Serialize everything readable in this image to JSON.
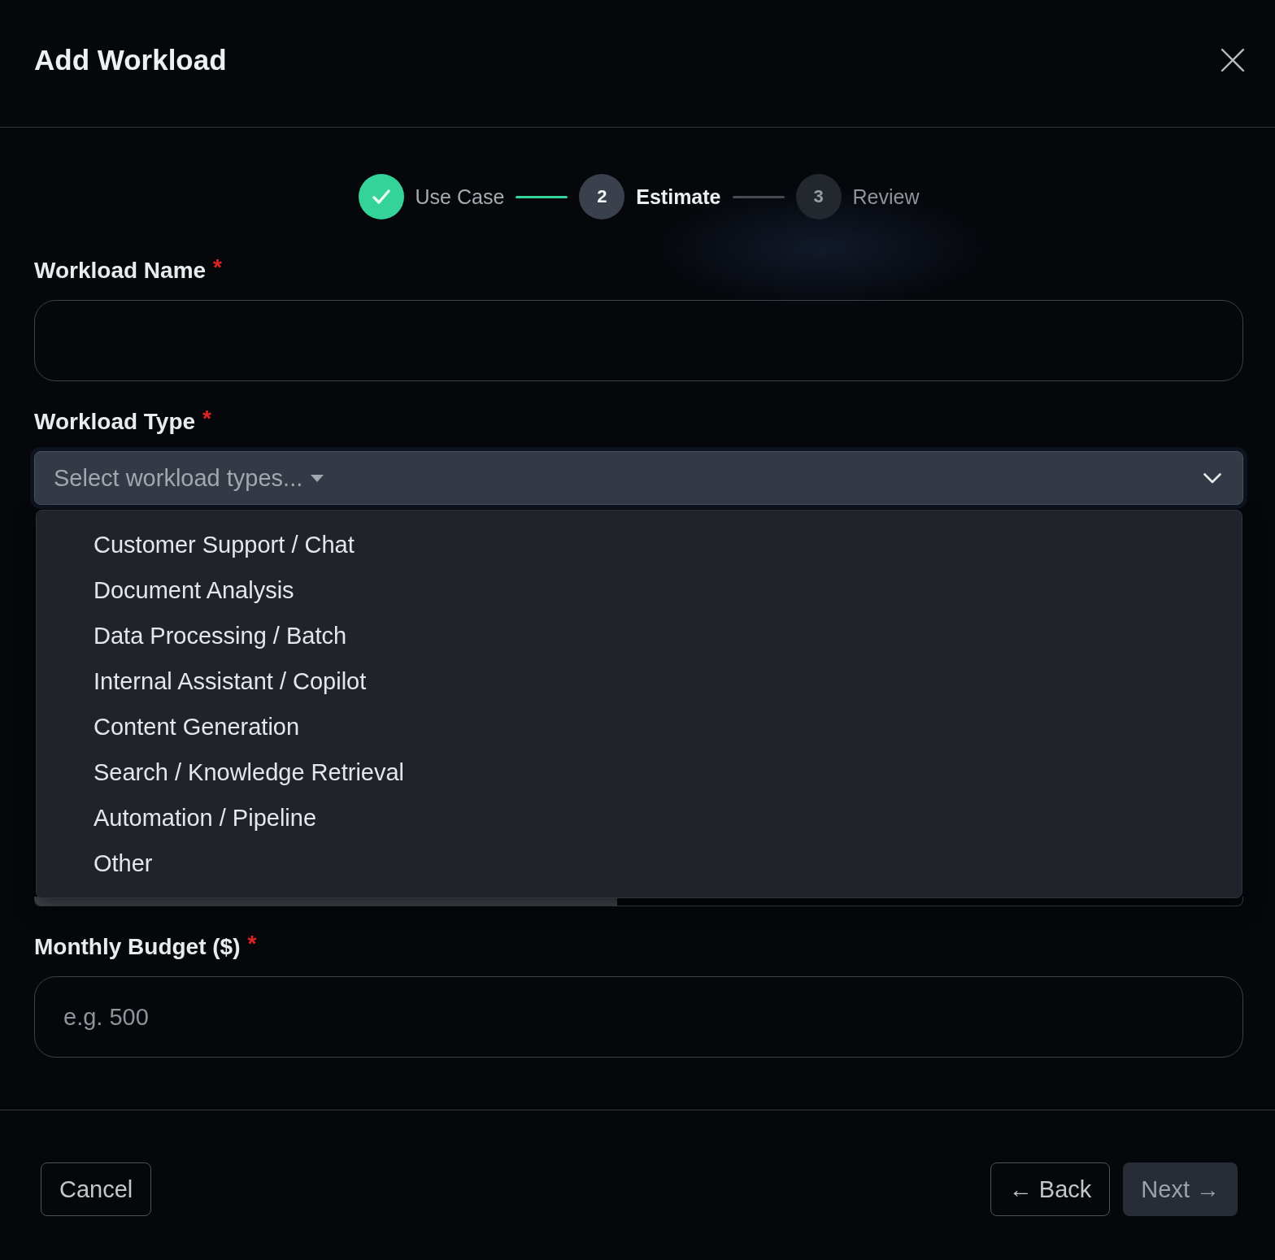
{
  "dialog": {
    "title": "Add Workload"
  },
  "steps": [
    {
      "label": "Use Case",
      "completed": true,
      "selected": false
    },
    {
      "number": "2",
      "label": "Estimate",
      "completed": false,
      "selected": true
    },
    {
      "number": "3",
      "label": "Review",
      "completed": false,
      "selected": false
    }
  ],
  "fields": [
    {
      "kind": "text",
      "label": "Workload Name",
      "required_mark": "*"
    },
    {
      "kind": "select",
      "label": "Workload Type",
      "required_mark": "*",
      "placeholder": "Select workload types...",
      "expanded": true,
      "options": [
        {
          "label": "Customer Support / Chat",
          "selected": false
        },
        {
          "label": "Document Analysis",
          "selected": false
        },
        {
          "label": "Data Processing / Batch",
          "selected": false
        },
        {
          "label": "Internal Assistant / Copilot",
          "selected": false
        },
        {
          "label": "Content Generation",
          "selected": false
        },
        {
          "label": "Search / Knowledge Retrieval",
          "selected": false
        },
        {
          "label": "Automation / Pipeline",
          "selected": false
        },
        {
          "label": "Other",
          "selected": false
        }
      ]
    },
    {
      "kind": "text",
      "label": "Monthly Budget ($)",
      "required_mark": "*",
      "placeholder": "e.g. 500"
    }
  ],
  "footer": {
    "left": [
      {
        "kind": "outline",
        "label": "Cancel",
        "disabled": false
      }
    ],
    "right": [
      {
        "kind": "outline",
        "label": "← Back",
        "disabled": false
      },
      {
        "kind": "filled",
        "label": "Next →",
        "disabled": true
      }
    ]
  }
}
